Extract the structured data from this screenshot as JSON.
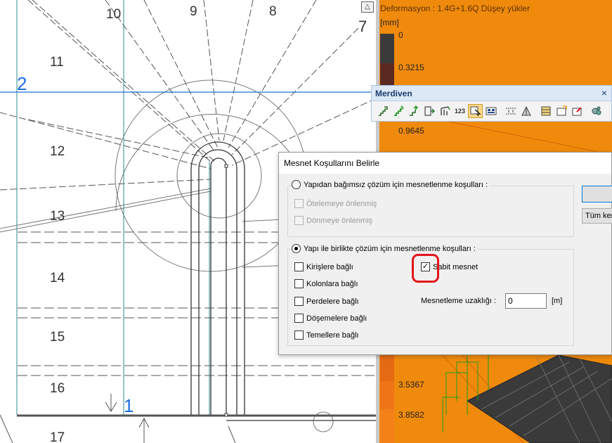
{
  "cad": {
    "step_numbers": [
      "10",
      "9",
      "8",
      "7",
      "11",
      "12",
      "13",
      "14",
      "15",
      "16",
      "17"
    ],
    "axis_labels": [
      "2",
      "1"
    ],
    "corner_button_glyph": "△"
  },
  "result_panel": {
    "title": "Deformasyon : 1.4G+1.6Q   Düşey yükler",
    "unit": "[mm]",
    "scale_values": [
      "0",
      "0.3215",
      "0.9645",
      "3.5367",
      "3.8582"
    ],
    "colors": {
      "background": "#f08a0c",
      "scale_top": "#3a3a3a",
      "scale_mid": "#8a2a1a",
      "scale_low": "#f07818"
    }
  },
  "toolbar": {
    "title": "Merdiven",
    "close_glyph": "×",
    "buttons": [
      {
        "icon": "stair-straight-icon"
      },
      {
        "icon": "stair-double-icon"
      },
      {
        "icon": "stair-add-icon"
      },
      {
        "icon": "stair-landing-icon"
      },
      {
        "icon": "stair-spiral-icon"
      },
      {
        "icon": "numbering-icon",
        "glyph": "123"
      },
      {
        "icon": "select-stair-icon",
        "active": true
      },
      {
        "icon": "stair-properties-icon"
      },
      {
        "icon": "dimension-icon"
      },
      {
        "icon": "section-icon"
      },
      {
        "icon": "support-icon"
      },
      {
        "icon": "support-conditions-icon"
      },
      {
        "icon": "erase-icon"
      },
      {
        "icon": "settings-icon"
      }
    ]
  },
  "dialog": {
    "title": "Mesnet Koşullarını Belirle",
    "independent_option": "Yapıdan bağımsız çözüm için mesnetlenme koşulları  :",
    "translation_restrained": "Ötelemeye önlenmiş",
    "rotation_restrained": "Dönmeye önlenmiş",
    "combined_option": "Yapı ile birlikte çözüm için mesnetlenme koşulları  :",
    "connections": [
      {
        "label": "Kirişlere bağlı",
        "checked": false
      },
      {
        "label": "Kolonlara bağlı",
        "checked": false
      },
      {
        "label": "Perdelere bağlı",
        "checked": false
      },
      {
        "label": "Döşemelere bağlı",
        "checked": false
      },
      {
        "label": "Temellere bağlı",
        "checked": false
      }
    ],
    "fixed_support": {
      "label": "Sabit mesnet",
      "checked": true
    },
    "distance_label": "Mesnetleme uzaklığı  :",
    "distance_value": "0",
    "distance_unit": "[m]",
    "ok_button": "",
    "apply_all_button": "Tüm ken"
  }
}
